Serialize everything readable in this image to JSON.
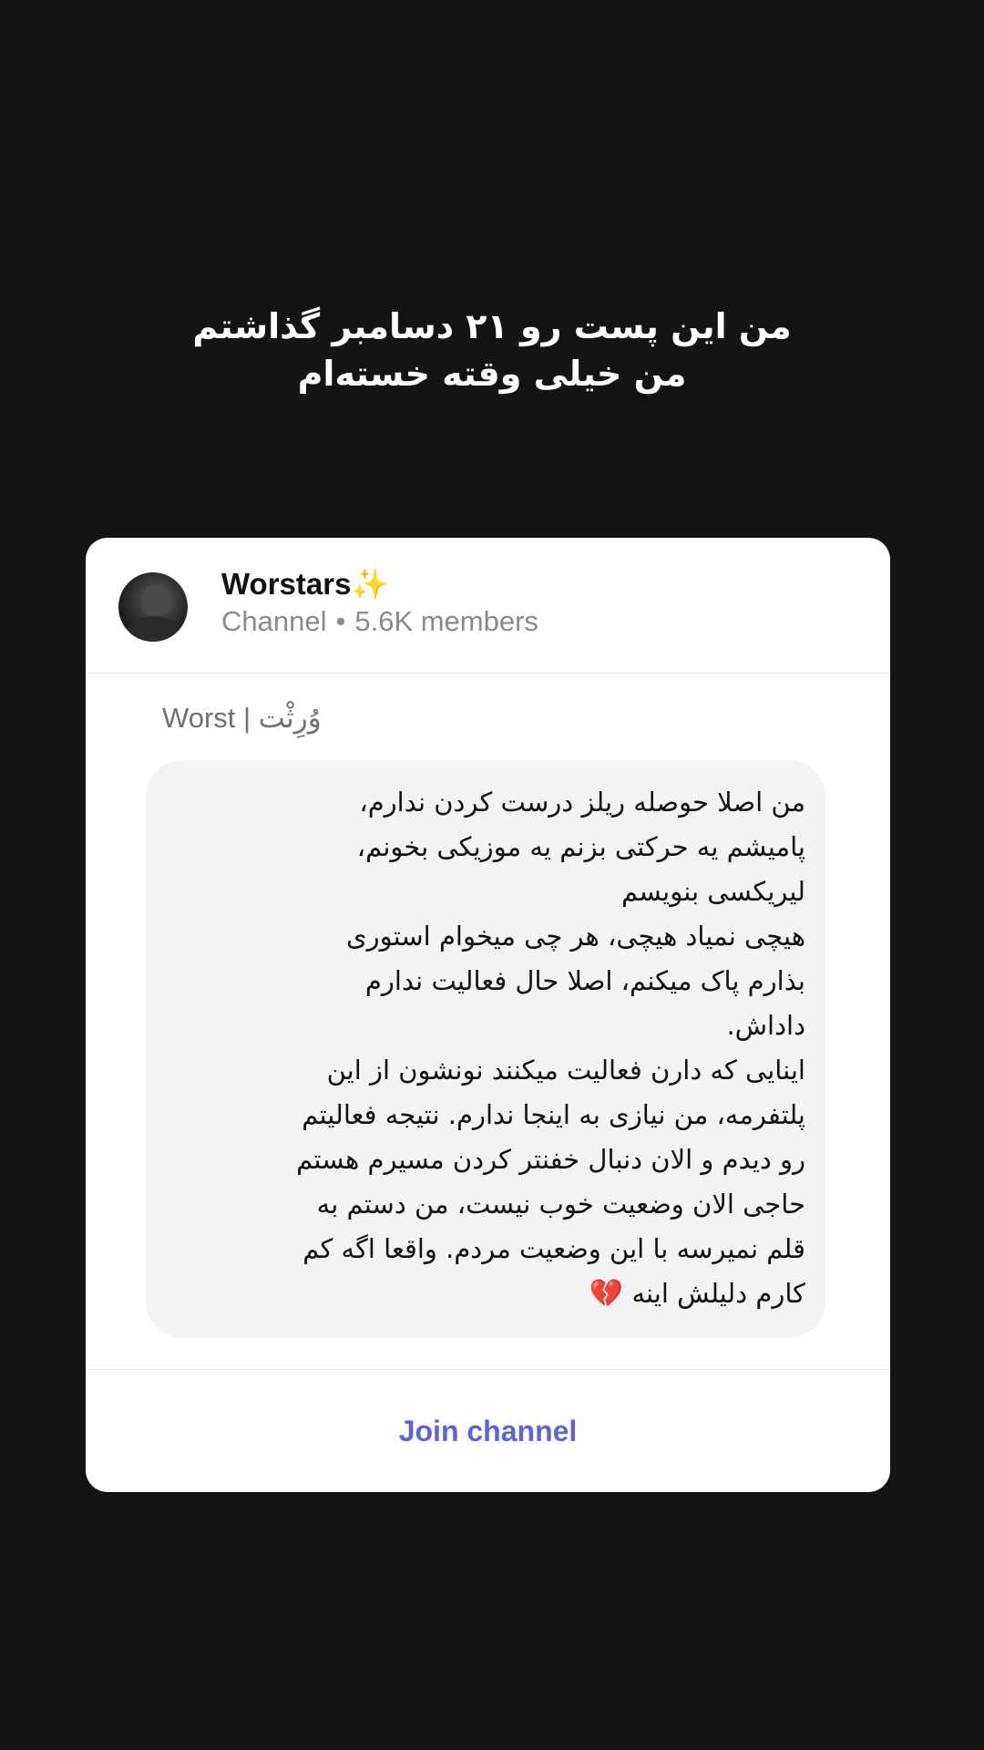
{
  "story": {
    "caption_lines": [
      "من این پست رو ۲۱ دسامبر گذاشتم",
      "من خیلی وقته خسته‌ام"
    ]
  },
  "channel": {
    "name": "Worstars✨",
    "type": "Channel",
    "separator": "•",
    "members": "5.6K members"
  },
  "post": {
    "sender": "Worst | وُرِثْت",
    "message_lines": [
      "من اصلا حوصله ریلز درست کردن ندارم،",
      "پامیشم یه حرکتی بزنم یه موزیکی بخونم،",
      "لیریکسی بنویسم",
      "هیچی نمیاد هیچی، هر چی میخوام استوری",
      "بذارم پاک میکنم، اصلا حال فعالیت ندارم",
      "داداش.",
      "اینایی که دارن فعالیت میکنند نونشون از این",
      "پلتفرمه، من نیازی به اینجا ندارم. نتیجه فعالیتم",
      "رو دیدم و الان دنبال خفنتر کردن مسیرم هستم",
      "حاجی الان وضعیت خوب نیست، من دستم به",
      "قلم نمیرسه با این وضعیت مردم. واقعا اگه کم",
      "کارم دلیلش اینه"
    ],
    "end_emoji": "💔",
    "end_icon": "broken-heart-icon"
  },
  "actions": {
    "join_label": "Join channel",
    "accent_color": "#5b64d8"
  },
  "colors": {
    "background": "#141414",
    "card": "#ffffff",
    "bubble": "#f2f3f5"
  }
}
